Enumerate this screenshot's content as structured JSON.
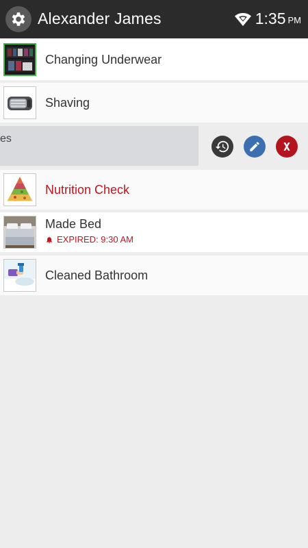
{
  "header": {
    "title": "Alexander James",
    "time": "1:35",
    "ampm": "PM",
    "settings_icon": "gear-icon",
    "wifi_icon": "wifi-icon"
  },
  "tasks": [
    {
      "label": "Changing Underwear",
      "thumb": "closet-photo"
    },
    {
      "label": "Shaving",
      "thumb": "razor-photo"
    },
    {
      "label": "es",
      "swiped": true
    },
    {
      "label": "Nutrition Check",
      "thumb": "food-pyramid-photo",
      "label_color": "#c0151f"
    },
    {
      "label": "Made Bed",
      "thumb": "bed-photo",
      "status": "EXPIRED: 9:30 AM"
    },
    {
      "label": "Cleaned Bathroom",
      "thumb": "bathroom-cleaning-photo"
    }
  ],
  "actions": {
    "history_icon": "history-icon",
    "edit_icon": "edit-icon",
    "delete_icon": "delete-icon"
  },
  "colors": {
    "header_bg": "#2b2b2b",
    "accent_red": "#c0151f",
    "edit_blue": "#3b6fb0",
    "history_dark": "#3a3a3a"
  }
}
